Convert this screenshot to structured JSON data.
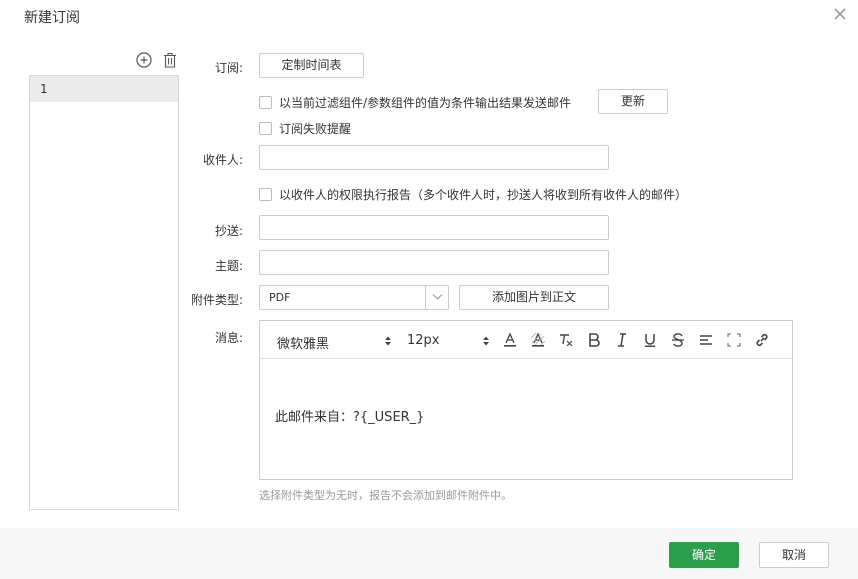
{
  "dialog": {
    "title": "新建订阅",
    "close_icon": "close-icon"
  },
  "list": {
    "items": [
      {
        "label": "1"
      }
    ],
    "add_icon": "add-circle-icon",
    "delete_icon": "trash-icon"
  },
  "form": {
    "subscribe_label": "订阅:",
    "schedule_button": "定制时间表",
    "filter_condition_text": "以当前过滤组件/参数组件的值为条件输出结果发送邮件",
    "refresh_button": "更新",
    "failure_alert_text": "订阅失败提醒",
    "recipients_label": "收件人:",
    "recipients_value": "",
    "run_as_recipient_text": "以收件人的权限执行报告（多个收件人时，抄送人将收到所有收件人的邮件）",
    "cc_label": "抄送:",
    "cc_value": "",
    "subject_label": "主题:",
    "subject_value": "",
    "attachment_type_label": "附件类型:",
    "attachment_type_value": "PDF",
    "add_image_button": "添加图片到正文",
    "message_label": "消息:",
    "hint": "选择附件类型为无时，报告不会添加到邮件附件中。"
  },
  "editor": {
    "font_family": "微软雅黑",
    "font_size": "12px",
    "toolbar_icons": [
      "font-color-icon",
      "background-color-icon",
      "clear-format-icon",
      "bold-icon",
      "italic-icon",
      "underline-icon",
      "strikethrough-icon",
      "align-icon",
      "fullscreen-icon",
      "link-icon"
    ],
    "body_text": "此邮件来自：?{_USER_}"
  },
  "footer": {
    "ok_button": "确定",
    "cancel_button": "取消",
    "ok_color": "#2a9e4b"
  }
}
